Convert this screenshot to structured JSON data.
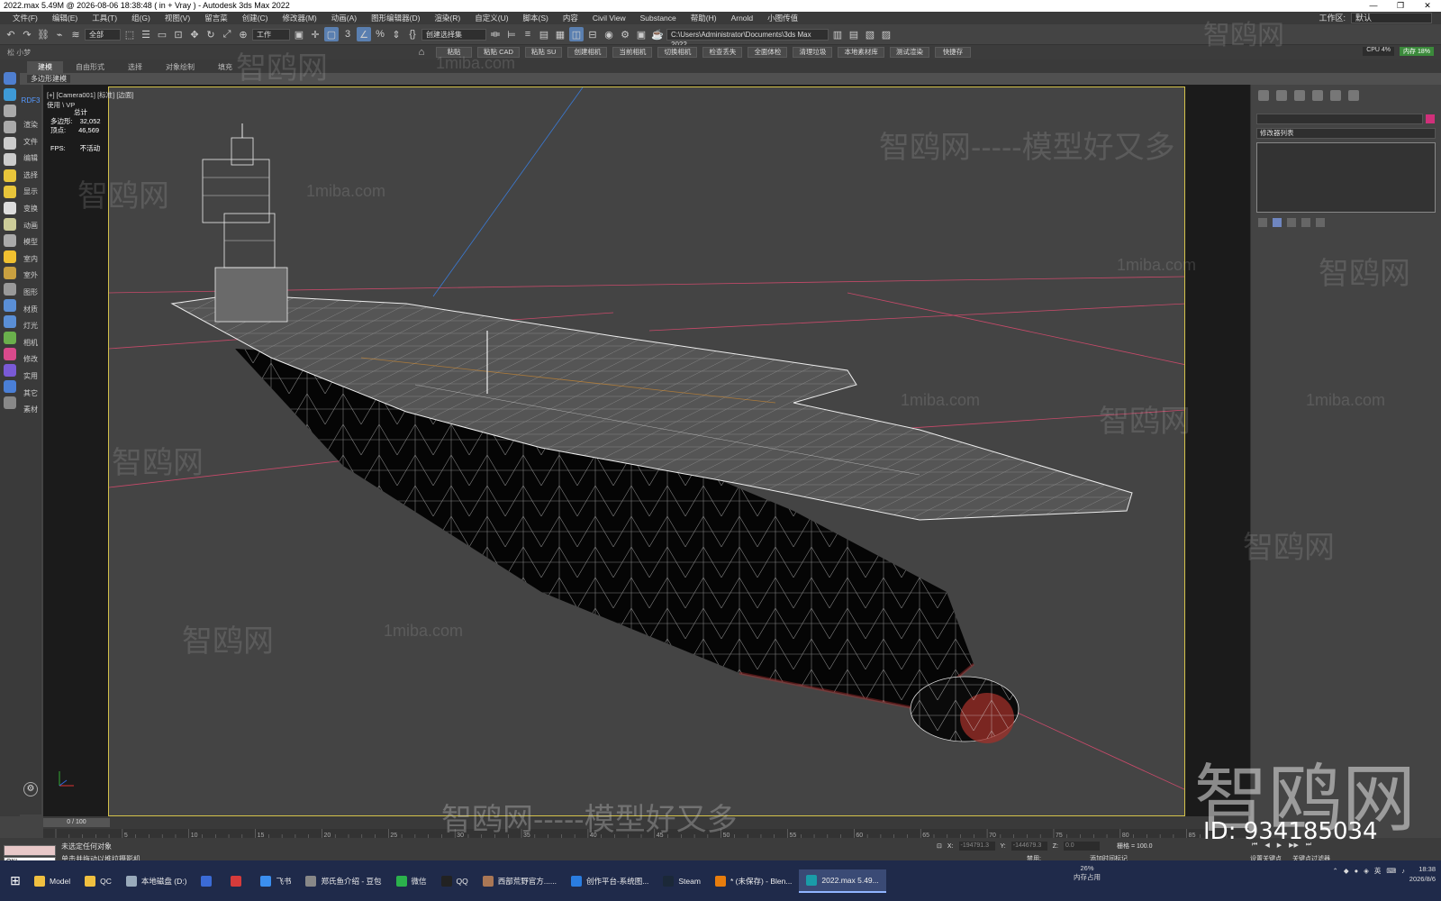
{
  "window": {
    "title": "2022.max  5.49M @ 2026-08-06 18:38:48  ( in + Vray ) - Autodesk 3ds Max 2022"
  },
  "menu": [
    "文件(F)",
    "编辑(E)",
    "工具(T)",
    "组(G)",
    "视图(V)",
    "留言菜",
    "创建(C)",
    "修改器(M)",
    "动画(A)",
    "图形编辑器(D)",
    "渲染(R)",
    "自定义(U)",
    "脚本(S)",
    "内容",
    "Civil View",
    "Substance",
    "帮助(H)",
    "Arnold",
    "小图传值"
  ],
  "workspace": {
    "label": "工作区:",
    "value": "默认"
  },
  "toolbar": {
    "filter": "全部",
    "coord": "工作",
    "selection_set": "创建选择集",
    "path": "C:\\Users\\Administrator\\Documents\\3ds Max 2022"
  },
  "ribbon": {
    "left": "松 小梦",
    "buttons": [
      "粘贴",
      "粘贴 CAD",
      "粘贴 SU",
      "创建相机",
      "当前相机",
      "切换相机",
      "检查丢失",
      "全面体检",
      "清理垃圾",
      "本地素材库",
      "测试渲染",
      "快捷存"
    ],
    "cpu": "CPU 4%",
    "mem": "内存 18%"
  },
  "tabs": [
    {
      "label": "建模",
      "active": true
    },
    {
      "label": "自由形式",
      "active": false
    },
    {
      "label": "选择",
      "active": false
    },
    {
      "label": "对象绘制",
      "active": false
    },
    {
      "label": "填充",
      "active": false
    }
  ],
  "subtab": "多边形建模",
  "left_labels": [
    "渲染",
    "文件",
    "编辑",
    "选择",
    "显示",
    "变换",
    "动画",
    "模型",
    "室内",
    "室外",
    "图形",
    "材质",
    "灯光",
    "相机",
    "修改",
    "实用",
    "其它",
    "素材"
  ],
  "left_tag": "RDF3",
  "viewport": {
    "label": "[+] [Camera001] [标准] [边面]",
    "sublabel": "使用 \\ VP",
    "stats": {
      "header": "总计",
      "poly_label": "多边形:",
      "poly_value": "32,052",
      "vert_label": "顶点:",
      "vert_value": "46,569",
      "fps_label": "FPS:",
      "fps_value": "不活动"
    }
  },
  "command_panel": {
    "modifier_list": "修改器列表"
  },
  "timeline": {
    "slider": "0 / 100",
    "ticks": [
      "5",
      "10",
      "15",
      "20",
      "25",
      "30",
      "35",
      "40",
      "45",
      "50",
      "55",
      "60",
      "65",
      "70",
      "75",
      "80",
      "85"
    ]
  },
  "status": {
    "line1": "未选定任何对象",
    "line2": "单击并拖动以推拉摄影机",
    "script_text": "OK!",
    "x_label": "X:",
    "x_value": "-194791.3",
    "y_label": "Y:",
    "y_value": "-144679.3",
    "z_label": "Z:",
    "z_value": "0.0",
    "grid": "栅格 = 100.0",
    "disabled": "禁用:",
    "add_time_tag": "添加时间标记",
    "auto_key": "设置关键点",
    "key_filter": "关键点过滤器"
  },
  "id_label": "ID: 934185034",
  "watermarks": {
    "site": "智鸥网",
    "slogan": "智鸥网-----模型好又多",
    "url": "1miba.com"
  },
  "taskbar": {
    "items": [
      {
        "label": "Model",
        "color": "#f0c040"
      },
      {
        "label": "QC",
        "color": "#f0c040"
      },
      {
        "label": "本地磁盘 (D:)",
        "color": "#9ab"
      },
      {
        "label": "",
        "color": "#3b6bd6"
      },
      {
        "label": "",
        "color": "#d63b3b"
      },
      {
        "label": "飞书",
        "color": "#3b8ff0"
      },
      {
        "label": "郑氏鱼介绍 - 豆包",
        "color": "#888"
      },
      {
        "label": "微信",
        "color": "#2bb24c"
      },
      {
        "label": "QQ",
        "color": "#222"
      },
      {
        "label": "西部荒野官方......",
        "color": "#a75"
      },
      {
        "label": "创作平台-系统图...",
        "color": "#2a7de1"
      },
      {
        "label": "Steam",
        "color": "#1b2838"
      },
      {
        "label": "* (未保存) - Blen...",
        "color": "#e87d0d"
      },
      {
        "label": "2022.max  5.49...",
        "color": "#1a9ca8"
      }
    ],
    "memory": "26%",
    "memory_label": "内存占用",
    "lang": "英",
    "time": "18:38",
    "date": "2026/8/6"
  }
}
